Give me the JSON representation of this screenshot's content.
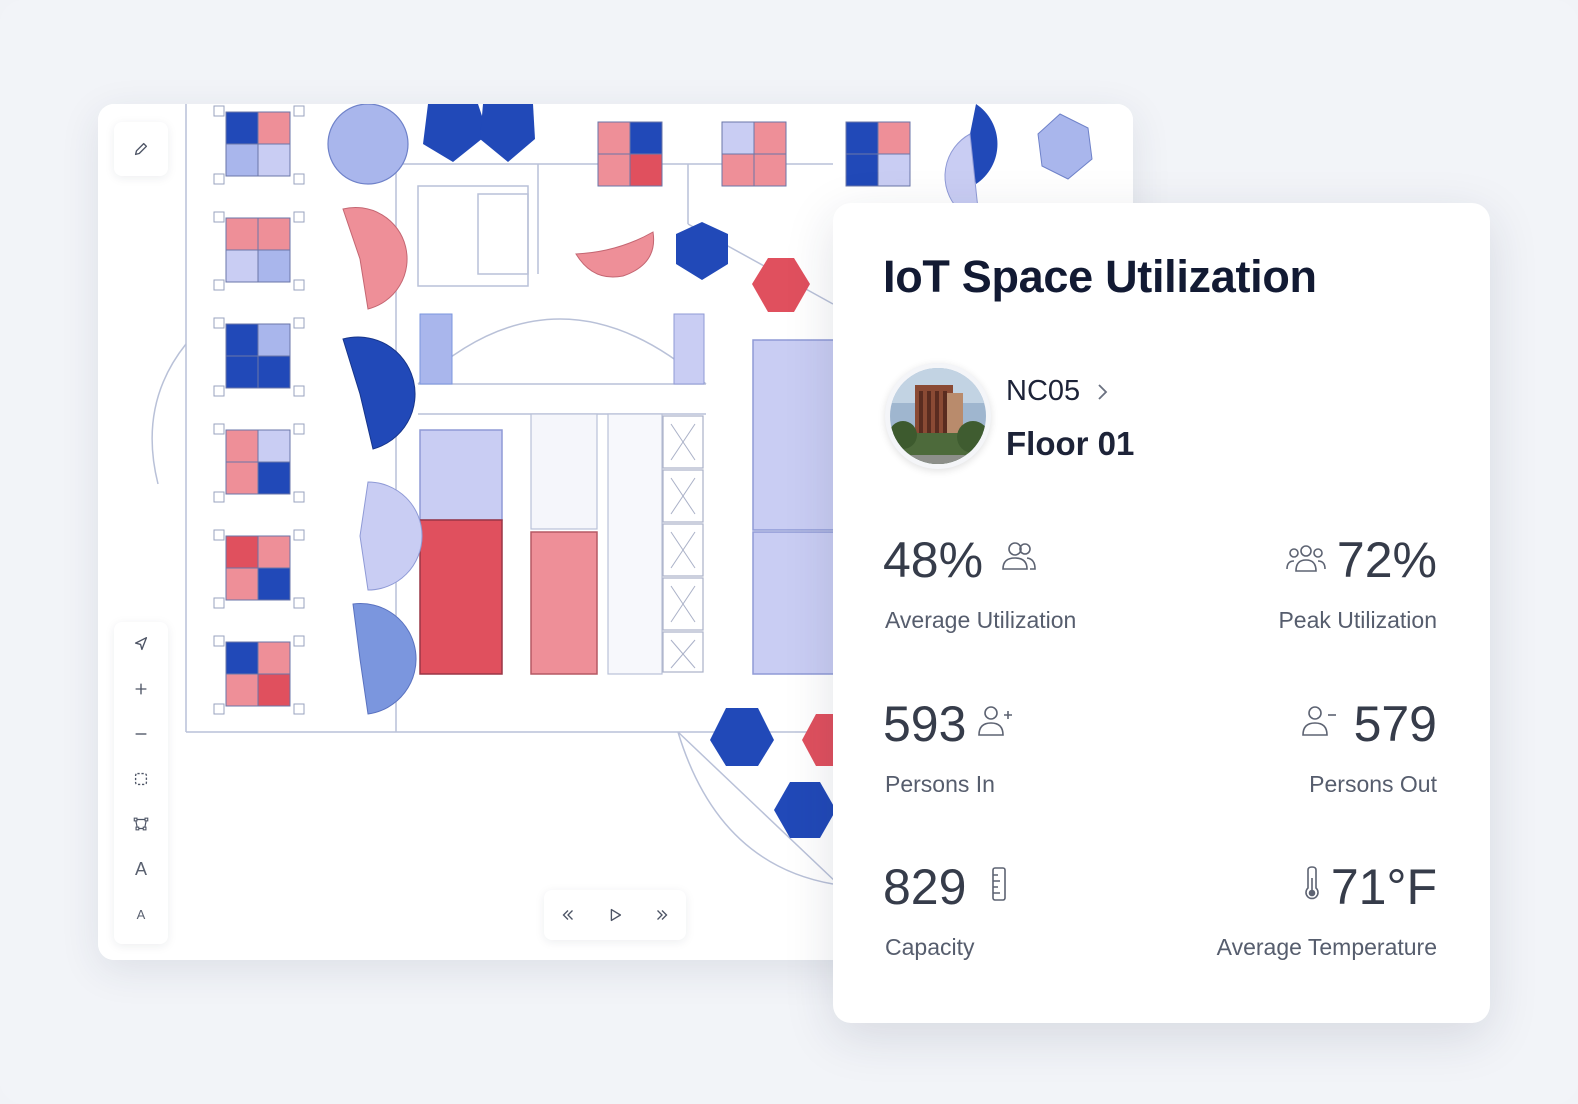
{
  "card": {
    "title": "IoT Space Utilization",
    "building": "NC05",
    "floor": "Floor 01"
  },
  "stats": {
    "avg_util": {
      "value": "48%",
      "label": "Average Utilization"
    },
    "peak_util": {
      "value": "72%",
      "label": "Peak Utilization"
    },
    "persons_in": {
      "value": "593",
      "label": "Persons In"
    },
    "persons_out": {
      "value": "579",
      "label": "Persons Out"
    },
    "capacity": {
      "value": "829",
      "label": "Capacity"
    },
    "avg_temp": {
      "value": "71°F",
      "label": "Average Temperature"
    }
  },
  "map": {
    "tools": [
      "pencil-icon",
      "pointer-icon",
      "zoom-in-icon",
      "zoom-out-icon",
      "select-area-icon",
      "polygon-icon",
      "text-large-icon",
      "text-small-icon"
    ],
    "tool_text": {
      "text_large": "A",
      "text_small": "A"
    },
    "playback": [
      "rewind-icon",
      "play-icon",
      "fast-forward-icon"
    ]
  },
  "colors": {
    "dark_blue": "#2149b8",
    "mid_blue": "#7b96de",
    "light_blue": "#c3ccf2",
    "pink": "#ee8f98",
    "red": "#e0505e",
    "floor_line": "#b9c1d8",
    "room_lavender": "#c9cdf3"
  }
}
